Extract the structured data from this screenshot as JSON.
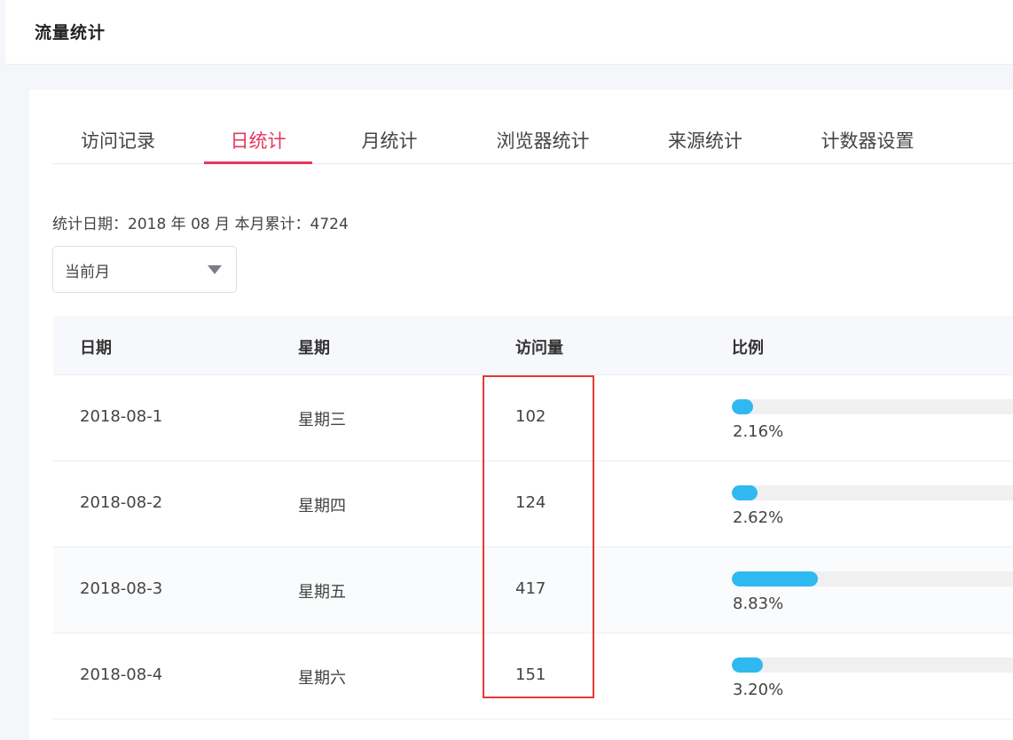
{
  "page": {
    "title": "流量统计"
  },
  "tabs": [
    {
      "label": "访问记录",
      "active": false
    },
    {
      "label": "日统计",
      "active": true
    },
    {
      "label": "月统计",
      "active": false
    },
    {
      "label": "浏览器统计",
      "active": false
    },
    {
      "label": "来源统计",
      "active": false
    },
    {
      "label": "计数器设置",
      "active": false
    }
  ],
  "summary": {
    "text": "统计日期：2018 年 08 月 本月累计：4724"
  },
  "month_select": {
    "value": "当前月"
  },
  "table": {
    "headers": [
      "日期",
      "星期",
      "访问量",
      "比例"
    ],
    "rows": [
      {
        "date": "2018-08-1",
        "weekday": "星期三",
        "visits": "102",
        "ratio": 0.0216,
        "ratio_label": "2.16%"
      },
      {
        "date": "2018-08-2",
        "weekday": "星期四",
        "visits": "124",
        "ratio": 0.0262,
        "ratio_label": "2.62%"
      },
      {
        "date": "2018-08-3",
        "weekday": "星期五",
        "visits": "417",
        "ratio": 0.0883,
        "ratio_label": "8.83%"
      },
      {
        "date": "2018-08-4",
        "weekday": "星期六",
        "visits": "151",
        "ratio": 0.032,
        "ratio_label": "3.20%"
      }
    ]
  },
  "colors": {
    "accent": "#e6375f",
    "bar": "#2fb9f0",
    "highlight_border": "#e53935"
  },
  "bar_full_ratio": 0.3
}
